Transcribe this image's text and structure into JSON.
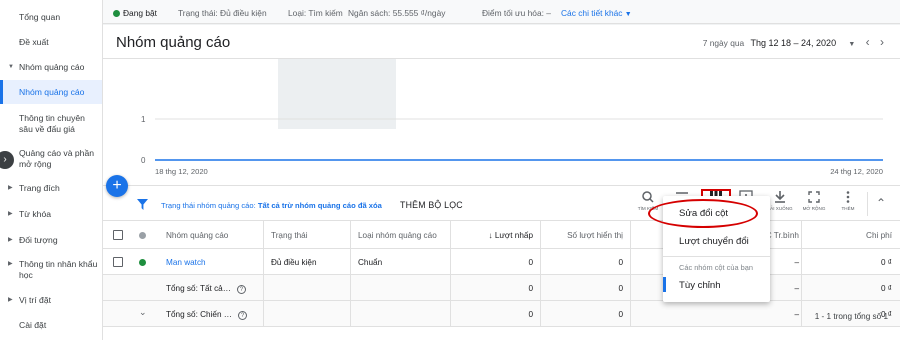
{
  "sidebar": {
    "items": [
      {
        "label": "Tổng quan"
      },
      {
        "label": "Đề xuất"
      },
      {
        "label": "Nhóm quảng cáo"
      },
      {
        "label": "Nhóm quảng cáo"
      },
      {
        "label": "Thông tin chuyên sâu về đấu giá"
      },
      {
        "label": "Quảng cáo và phần mở rộng"
      },
      {
        "label": "Trang đích"
      },
      {
        "label": "Từ khóa"
      },
      {
        "label": "Đối tượng"
      },
      {
        "label": "Thông tin nhân khẩu học"
      },
      {
        "label": "Vị trí đặt"
      },
      {
        "label": "Cài đặt"
      }
    ]
  },
  "statusbar": {
    "status": "Đang bật",
    "state": "Trạng thái: Đủ điều kiện",
    "type": "Loại: Tìm kiếm",
    "budget": "Ngân sách: 55.555 ₫/ngày",
    "optimization": "Điểm tối ưu hóa: –",
    "details": "Các chi tiết khác"
  },
  "header": {
    "title": "Nhóm quảng cáo",
    "date_prefix": "7 ngày qua",
    "date_range": "Thg 12 18 – 24, 2020"
  },
  "chart": {
    "y_ticks": [
      "1",
      "0"
    ],
    "x_start": "18 thg 12, 2020",
    "x_end": "24 thg 12, 2020"
  },
  "filter": {
    "label": "Trạng thái nhóm quảng cáo:",
    "value": "Tất cả trừ nhóm quảng cáo đã xóa",
    "add": "THÊM BỘ LỌC"
  },
  "toolbar": {
    "search": "TÌM KIẾM",
    "segment": "PHÂN ĐOẠN",
    "columns": "CỘT",
    "reports": "BÁO CÁO",
    "download": "TẢI XUỐNG",
    "expand": "MỞ RỘNG",
    "more": "THÊM"
  },
  "table": {
    "headers": {
      "name": "Nhóm quảng cáo",
      "status": "Trạng thái",
      "type": "Loại nhóm quảng cáo",
      "clicks": "Lượt nhấp",
      "impressions": "Số lượt hiển thị",
      "avg": "C Tr.bình",
      "cost": "Chi phí"
    },
    "rows": [
      {
        "name": "Man watch",
        "status": "Đủ điều kiện",
        "type": "Chuẩn",
        "clicks": "0",
        "impressions": "0",
        "avg": "–",
        "cost": "0 ₫"
      },
      {
        "name": "Tổng số: Tất cả…",
        "clicks": "0",
        "impressions": "0",
        "avg": "–",
        "cost": "0 ₫"
      },
      {
        "name": "Tổng số: Chiến …",
        "clicks": "0",
        "impressions": "0",
        "avg": "–",
        "cost": "0 ₫"
      }
    ],
    "footer": "1 - 1 trong tổng số 1"
  },
  "dropdown": {
    "edit_columns": "Sửa đổi cột",
    "conversions": "Lượt chuyển đổi",
    "group_label": "Các nhóm cột của bạn",
    "custom": "Tùy chỉnh"
  },
  "colors": {
    "accent": "#1a73e8",
    "highlight": "#d50000",
    "enabled": "#1e8e3e"
  }
}
